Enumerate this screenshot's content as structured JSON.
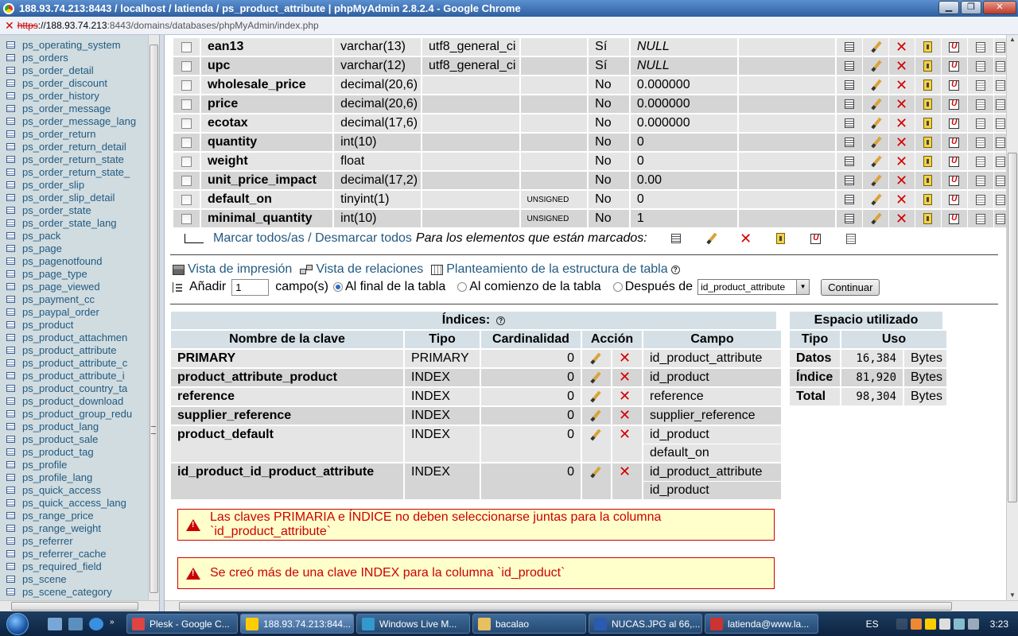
{
  "window": {
    "title": "188.93.74.213:8443 / localhost / latienda / ps_product_attribute | phpMyAdmin 2.8.2.4 - Google Chrome",
    "buttons": {
      "minimize": "▁",
      "maximize": "❐",
      "close": "✕"
    }
  },
  "address": {
    "scheme": "https",
    "host": "://188.93.74.213",
    "path": ":8443/domains/databases/phpMyAdmin/index.php"
  },
  "sidebar": {
    "tables": [
      "ps_operating_system",
      "ps_orders",
      "ps_order_detail",
      "ps_order_discount",
      "ps_order_history",
      "ps_order_message",
      "ps_order_message_lang",
      "ps_order_return",
      "ps_order_return_detail",
      "ps_order_return_state",
      "ps_order_return_state_",
      "ps_order_slip",
      "ps_order_slip_detail",
      "ps_order_state",
      "ps_order_state_lang",
      "ps_pack",
      "ps_page",
      "ps_pagenotfound",
      "ps_page_type",
      "ps_page_viewed",
      "ps_payment_cc",
      "ps_paypal_order",
      "ps_product",
      "ps_product_attachmen",
      "ps_product_attribute",
      "ps_product_attribute_c",
      "ps_product_attribute_i",
      "ps_product_country_ta",
      "ps_product_download",
      "ps_product_group_redu",
      "ps_product_lang",
      "ps_product_sale",
      "ps_product_tag",
      "ps_profile",
      "ps_profile_lang",
      "ps_quick_access",
      "ps_quick_access_lang",
      "ps_range_price",
      "ps_range_weight",
      "ps_referrer",
      "ps_referrer_cache",
      "ps_required_field",
      "ps_scene",
      "ps_scene_category"
    ]
  },
  "fields": [
    {
      "name": "ean13",
      "type": "varchar(13)",
      "collation": "utf8_general_ci",
      "attributes": "",
      "null": "Sí",
      "default": "NULL",
      "default_italic": true,
      "extra": ""
    },
    {
      "name": "upc",
      "type": "varchar(12)",
      "collation": "utf8_general_ci",
      "attributes": "",
      "null": "Sí",
      "default": "NULL",
      "default_italic": true,
      "extra": ""
    },
    {
      "name": "wholesale_price",
      "type": "decimal(20,6)",
      "collation": "",
      "attributes": "",
      "null": "No",
      "default": "0.000000",
      "extra": ""
    },
    {
      "name": "price",
      "type": "decimal(20,6)",
      "collation": "",
      "attributes": "",
      "null": "No",
      "default": "0.000000",
      "extra": ""
    },
    {
      "name": "ecotax",
      "type": "decimal(17,6)",
      "collation": "",
      "attributes": "",
      "null": "No",
      "default": "0.000000",
      "extra": ""
    },
    {
      "name": "quantity",
      "type": "int(10)",
      "collation": "",
      "attributes": "",
      "null": "No",
      "default": "0",
      "extra": ""
    },
    {
      "name": "weight",
      "type": "float",
      "collation": "",
      "attributes": "",
      "null": "No",
      "default": "0",
      "extra": ""
    },
    {
      "name": "unit_price_impact",
      "type": "decimal(17,2)",
      "collation": "",
      "attributes": "",
      "null": "No",
      "default": "0.00",
      "extra": ""
    },
    {
      "name": "default_on",
      "type": "tinyint(1)",
      "collation": "",
      "attributes": "UNSIGNED",
      "null": "No",
      "default": "0",
      "extra": ""
    },
    {
      "name": "minimal_quantity",
      "type": "int(10)",
      "collation": "",
      "attributes": "UNSIGNED",
      "null": "No",
      "default": "1",
      "extra": ""
    }
  ],
  "row_icons": [
    "browse-icon",
    "edit-icon",
    "drop-icon",
    "primary-icon",
    "unique-icon",
    "index-icon"
  ],
  "check_all": {
    "check_all_label": "Marcar todos/as",
    "separator": " / ",
    "uncheck_all_label": "Desmarcar todos",
    "with_selected": "Para los elementos que están marcados:"
  },
  "actions": {
    "print_view": "Vista de impresión",
    "relation_view": "Vista de relaciones",
    "propose_structure": "Planteamiento de la estructura de tabla",
    "add_label": "Añadir",
    "add_count": "1",
    "fields_label": "campo(s)",
    "at_end": "Al final de la tabla",
    "at_beginning": "Al comienzo de la tabla",
    "after": "Después de",
    "after_field": "id_product_attribute",
    "go_button": "Continuar"
  },
  "indexes": {
    "title": "Índices:",
    "headers": {
      "keyname": "Nombre de la clave",
      "type": "Tipo",
      "cardinality": "Cardinalidad",
      "action": "Acción",
      "field": "Campo"
    },
    "rows": [
      {
        "keyname": "PRIMARY",
        "type": "PRIMARY",
        "cardinality": "0",
        "fields": [
          "id_product_attribute"
        ]
      },
      {
        "keyname": "product_attribute_product",
        "type": "INDEX",
        "cardinality": "0",
        "fields": [
          "id_product"
        ]
      },
      {
        "keyname": "reference",
        "type": "INDEX",
        "cardinality": "0",
        "fields": [
          "reference"
        ]
      },
      {
        "keyname": "supplier_reference",
        "type": "INDEX",
        "cardinality": "0",
        "fields": [
          "supplier_reference"
        ]
      },
      {
        "keyname": "product_default",
        "type": "INDEX",
        "cardinality": "0",
        "fields": [
          "id_product",
          "default_on"
        ]
      },
      {
        "keyname": "id_product_id_product_attribute",
        "type": "INDEX",
        "cardinality": "0",
        "fields": [
          "id_product_attribute",
          "id_product"
        ]
      }
    ]
  },
  "space": {
    "title": "Espacio utilizado",
    "headers": {
      "type": "Tipo",
      "usage": "Uso"
    },
    "rows": [
      {
        "type": "Datos",
        "value": "16,384",
        "unit": "Bytes"
      },
      {
        "type": "Índice",
        "value": "81,920",
        "unit": "Bytes"
      },
      {
        "type": "Total",
        "value": "98,304",
        "unit": "Bytes"
      }
    ]
  },
  "errors": [
    "Las claves PRIMARIA e ÍNDICE no deben seleccionarse juntas para la columna `id_product_attribute`",
    "Se creó más de una clave INDEX para la columna `id_product`"
  ],
  "taskbar": {
    "tasks": [
      {
        "label": "Plesk - Google C...",
        "color": "#d44"
      },
      {
        "label": "188.93.74.213:844...",
        "color": "#fc0",
        "active": true
      },
      {
        "label": "Windows Live M...",
        "color": "#39c"
      },
      {
        "label": "bacalao",
        "color": "#e8c060"
      },
      {
        "label": "NUCAS.JPG al 66,...",
        "color": "#2a5bb0"
      },
      {
        "label": "latienda@www.la...",
        "color": "#c33"
      }
    ],
    "lang": "ES",
    "clock": "3:23"
  },
  "colors": {
    "link": "#235a81",
    "error": "#cc0000",
    "error_bg": "#ffffcc",
    "row_odd": "#e5e5e5",
    "row_even": "#d5d5d5",
    "header": "#d5e0e6",
    "sidebar_bg": "#d0dce0"
  }
}
